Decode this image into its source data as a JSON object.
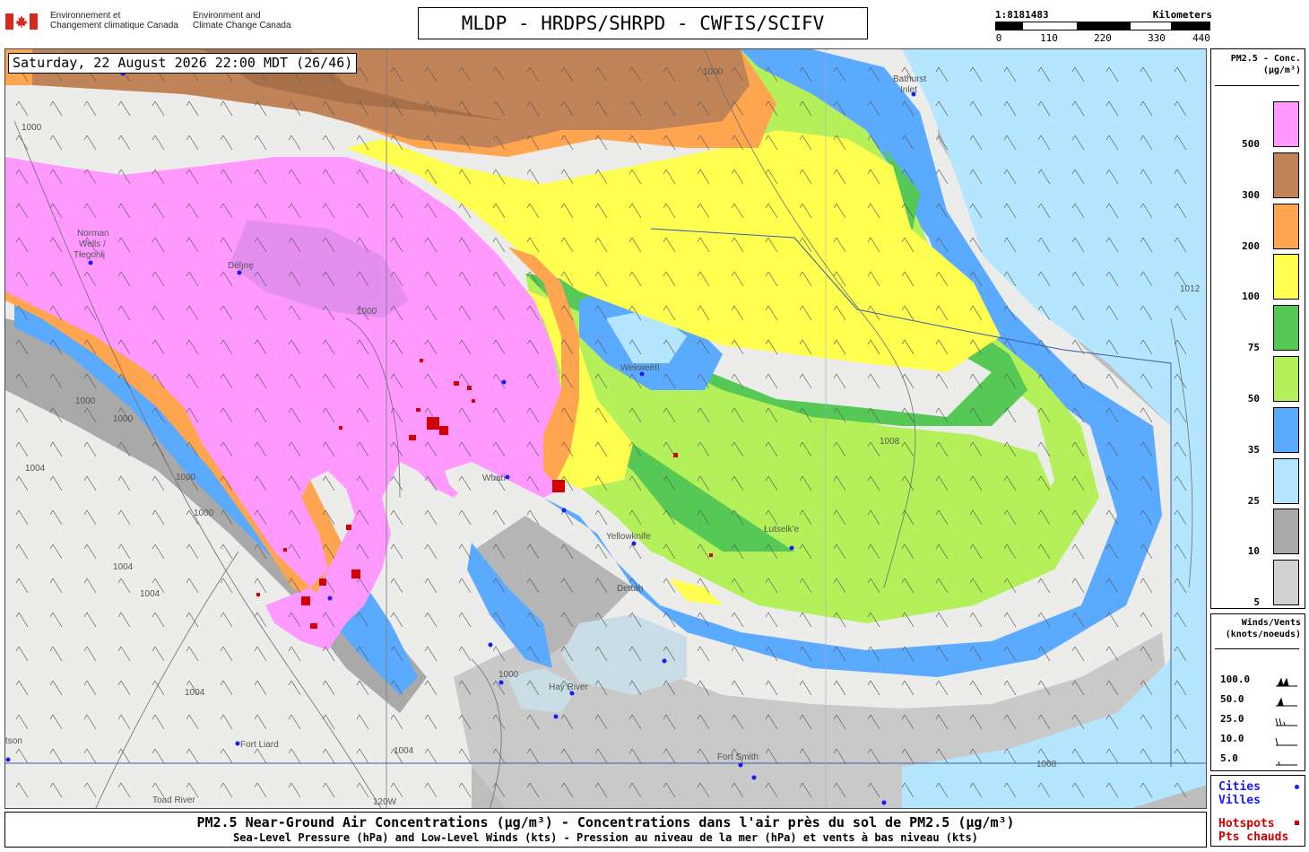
{
  "header": {
    "gov_fr_line1": "Environnement et",
    "gov_fr_line2": "Changement climatique Canada",
    "gov_en_line1": "Environment and",
    "gov_en_line2": "Climate Change Canada",
    "title": "MLDP - HRDPS/SHRPD - CWFIS/SCIFV"
  },
  "scale": {
    "ratio": "1:8181483",
    "unit": "Kilometers",
    "ticks": [
      "0",
      "110",
      "220",
      "330",
      "440"
    ]
  },
  "map": {
    "timestamp": "Saturday, 22 August 2026 22:00 MDT (26/46)",
    "places": {
      "norman_wells_1": "Norman",
      "norman_wells_2": "Wells /",
      "norman_wells_3": "Tłegohłį",
      "deline": "Délı̨nę",
      "bathurst_1": "Bathurst",
      "bathurst_2": "Inlet",
      "wekweeti": "Wekweètì",
      "whati": "Whatì",
      "yellowknife": "Yellowknife",
      "lutselk": "Łutselk'e",
      "detah": "Dettah",
      "hay_river": "Hay River",
      "fort_liard": "Fort Liard",
      "fort_smith": "Fort Smith",
      "toad_river": "Toad River",
      "watson": "tson"
    },
    "isobar_labels": [
      "1000",
      "1000",
      "1000",
      "1000",
      "1000",
      "1000",
      "1000",
      "1004",
      "1004",
      "1004",
      "1004",
      "1004",
      "1008",
      "1008",
      "1012",
      "1000"
    ],
    "meridian_label": "120W"
  },
  "legend": {
    "title_line1": "PM2.5 - Conc.",
    "title_line2": "(µg/m³)",
    "levels": [
      {
        "label": "500",
        "color": "#ff99ff"
      },
      {
        "label": "300",
        "color": "#c08458"
      },
      {
        "label": "200",
        "color": "#ffa54f"
      },
      {
        "label": "100",
        "color": "#ffff50"
      },
      {
        "label": "75",
        "color": "#55c855"
      },
      {
        "label": "50",
        "color": "#b4f05a"
      },
      {
        "label": "35",
        "color": "#5aaaff"
      },
      {
        "label": "25",
        "color": "#b4e6ff"
      },
      {
        "label": "10",
        "color": "#a8a8a8"
      },
      {
        "label": "5",
        "color": "#d2d2d2"
      }
    ]
  },
  "winds": {
    "title_line1": "Winds/Vents",
    "title_line2": "(knots/noeuds)",
    "speeds": [
      "100.0",
      "50.0",
      "25.0",
      "10.0",
      "5.0"
    ]
  },
  "key": {
    "cities_en": "Cities",
    "cities_fr": "Villes",
    "hotspots_en": "Hotspots",
    "hotspots_fr": "Pts chauds",
    "city_color": "#1a1aff",
    "hotspot_color": "#d40000"
  },
  "footer": {
    "line1": "PM2.5 Near-Ground Air Concentrations (µg/m³) - Concentrations dans l'air près du sol de PM2.5 (µg/m³)",
    "line2": "Sea-Level Pressure (hPa) and Low-Level Winds (kts) - Pression au niveau de la mer (hPa) et vents à bas niveau (kts)"
  }
}
